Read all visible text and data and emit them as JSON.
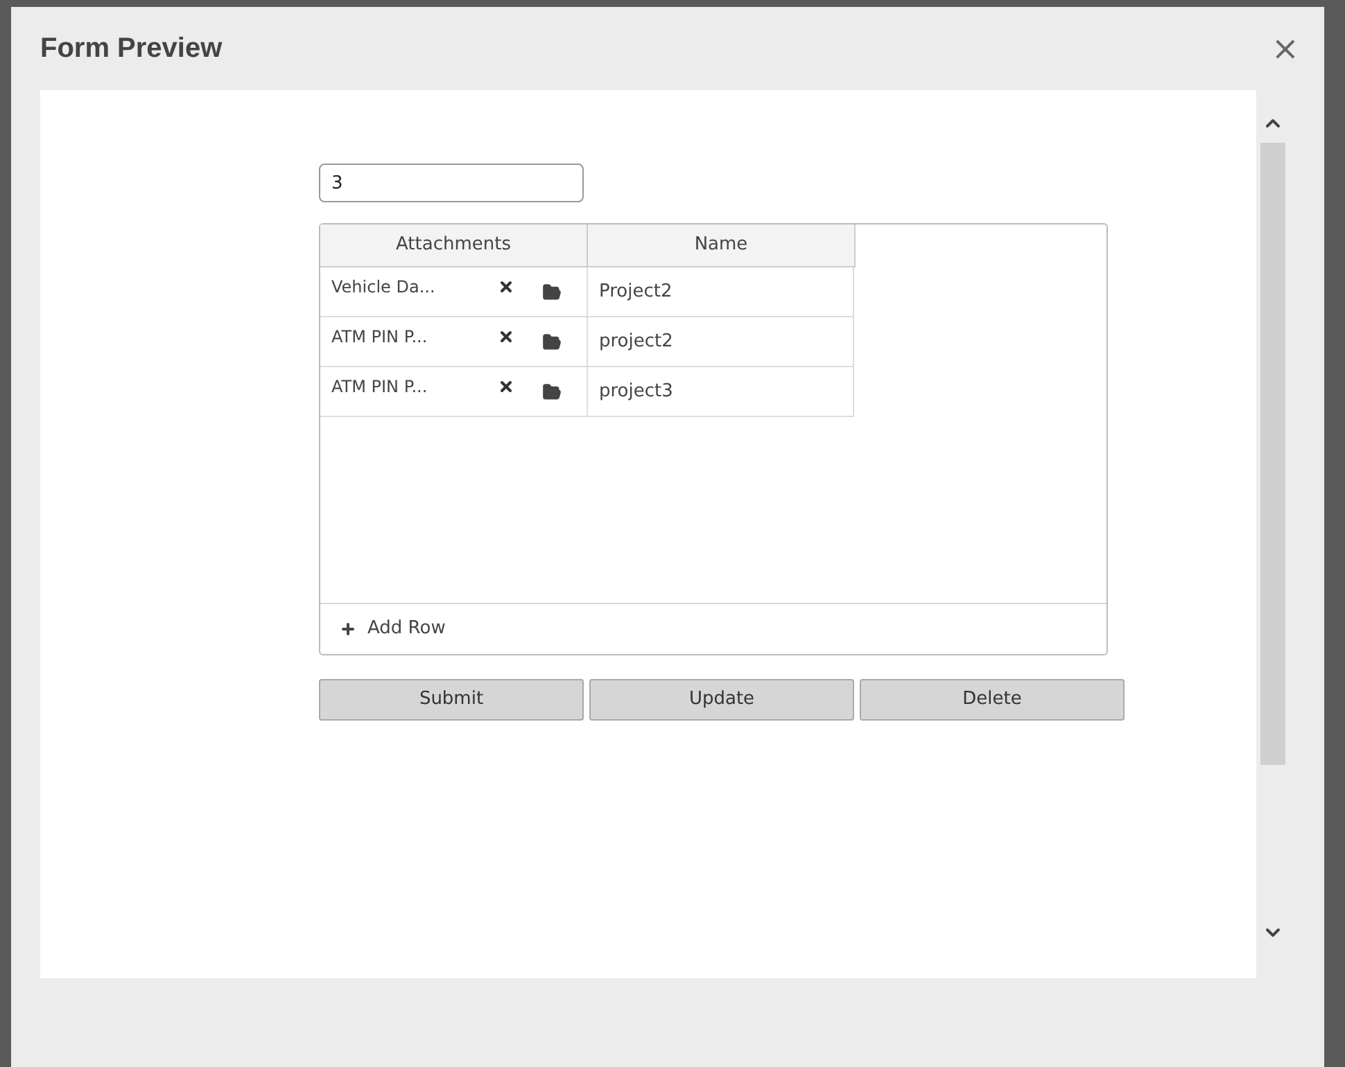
{
  "dialog": {
    "title": "Form Preview",
    "close": "×"
  },
  "field": {
    "value": "3"
  },
  "table": {
    "columns": [
      "Attachments",
      "Name"
    ],
    "rows": [
      {
        "attachment": "Vehicle Da...",
        "name": "Project2"
      },
      {
        "attachment": "ATM PIN P...",
        "name": "project2"
      },
      {
        "attachment": "ATM PIN P...",
        "name": "project3"
      }
    ],
    "add_row": "Add Row"
  },
  "buttons": [
    "Submit",
    "Update",
    "Delete"
  ]
}
